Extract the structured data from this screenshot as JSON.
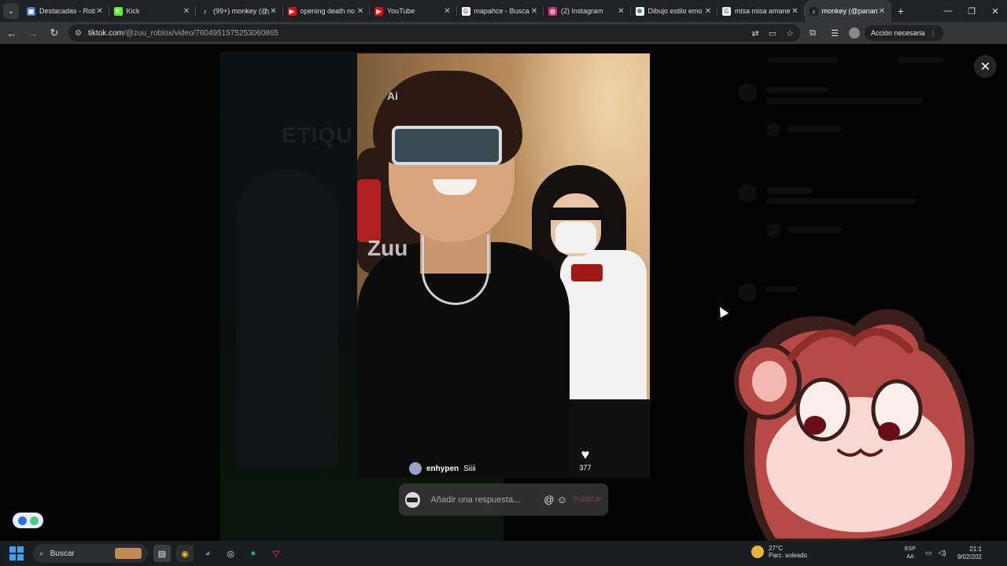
{
  "browser": {
    "tabs": [
      {
        "title": "Destacadas - Robl",
        "favicon": "roblox-icon",
        "color": "#4b6ef5",
        "glyph": "▣",
        "active": false
      },
      {
        "title": "Kick",
        "favicon": "kick-icon",
        "color": "#53fc18",
        "glyph": "K",
        "active": false
      },
      {
        "title": "(99+) monkey (@p",
        "favicon": "tiktok-icon",
        "color": "#202124",
        "glyph": "♪",
        "active": false
      },
      {
        "title": "opening death no",
        "favicon": "youtube-icon",
        "color": "#ff0000",
        "glyph": "▶",
        "active": false
      },
      {
        "title": "YouTube",
        "favicon": "youtube-icon",
        "color": "#ff0000",
        "glyph": "▶",
        "active": false
      },
      {
        "title": "mapahce - Buscar",
        "favicon": "google-icon",
        "color": "#ffffff",
        "glyph": "G",
        "active": false
      },
      {
        "title": "(2) Instagram",
        "favicon": "instagram-icon",
        "color": "#d62976",
        "glyph": "◎",
        "active": false
      },
      {
        "title": "Dibujo estilo emo",
        "favicon": "chatgpt-icon",
        "color": "#ffffff",
        "glyph": "✺",
        "active": false
      },
      {
        "title": "misa misa amane",
        "favicon": "google-icon",
        "color": "#ffffff",
        "glyph": "G",
        "active": false
      },
      {
        "title": "monkey (@panam",
        "favicon": "tiktok-icon",
        "color": "#202124",
        "glyph": "♪",
        "active": true
      }
    ],
    "new_tab": "+",
    "url_host": "tiktok.com",
    "url_path": "/@zuu_roblox/video/7604951575253060865",
    "action_pill": "Acción necesaria"
  },
  "video": {
    "watermark_ai": "Ai",
    "watermark_user": "Zuu",
    "comment_user": "enhypen",
    "comment_text": "Siiii",
    "like_count": "377",
    "close_label": "✕"
  },
  "reply_bar": {
    "placeholder": "Añadir una respuesta...",
    "mention_icon": "@",
    "emoji_icon": "☺",
    "send_label": "Publicar"
  },
  "background": {
    "ghost_text": "ETIQU"
  },
  "taskbar": {
    "search_label": "Buscar",
    "apps": [
      "file-explorer-icon",
      "chrome-icon",
      "discord-icon",
      "obs-icon",
      "spotify-icon",
      "valorant-icon"
    ],
    "weather_temp": "27°C",
    "weather_desc": "Parc. soleado",
    "lang_top": "ESP",
    "lang_bottom": "AA",
    "time": "21:1",
    "date": "9/02/202"
  }
}
